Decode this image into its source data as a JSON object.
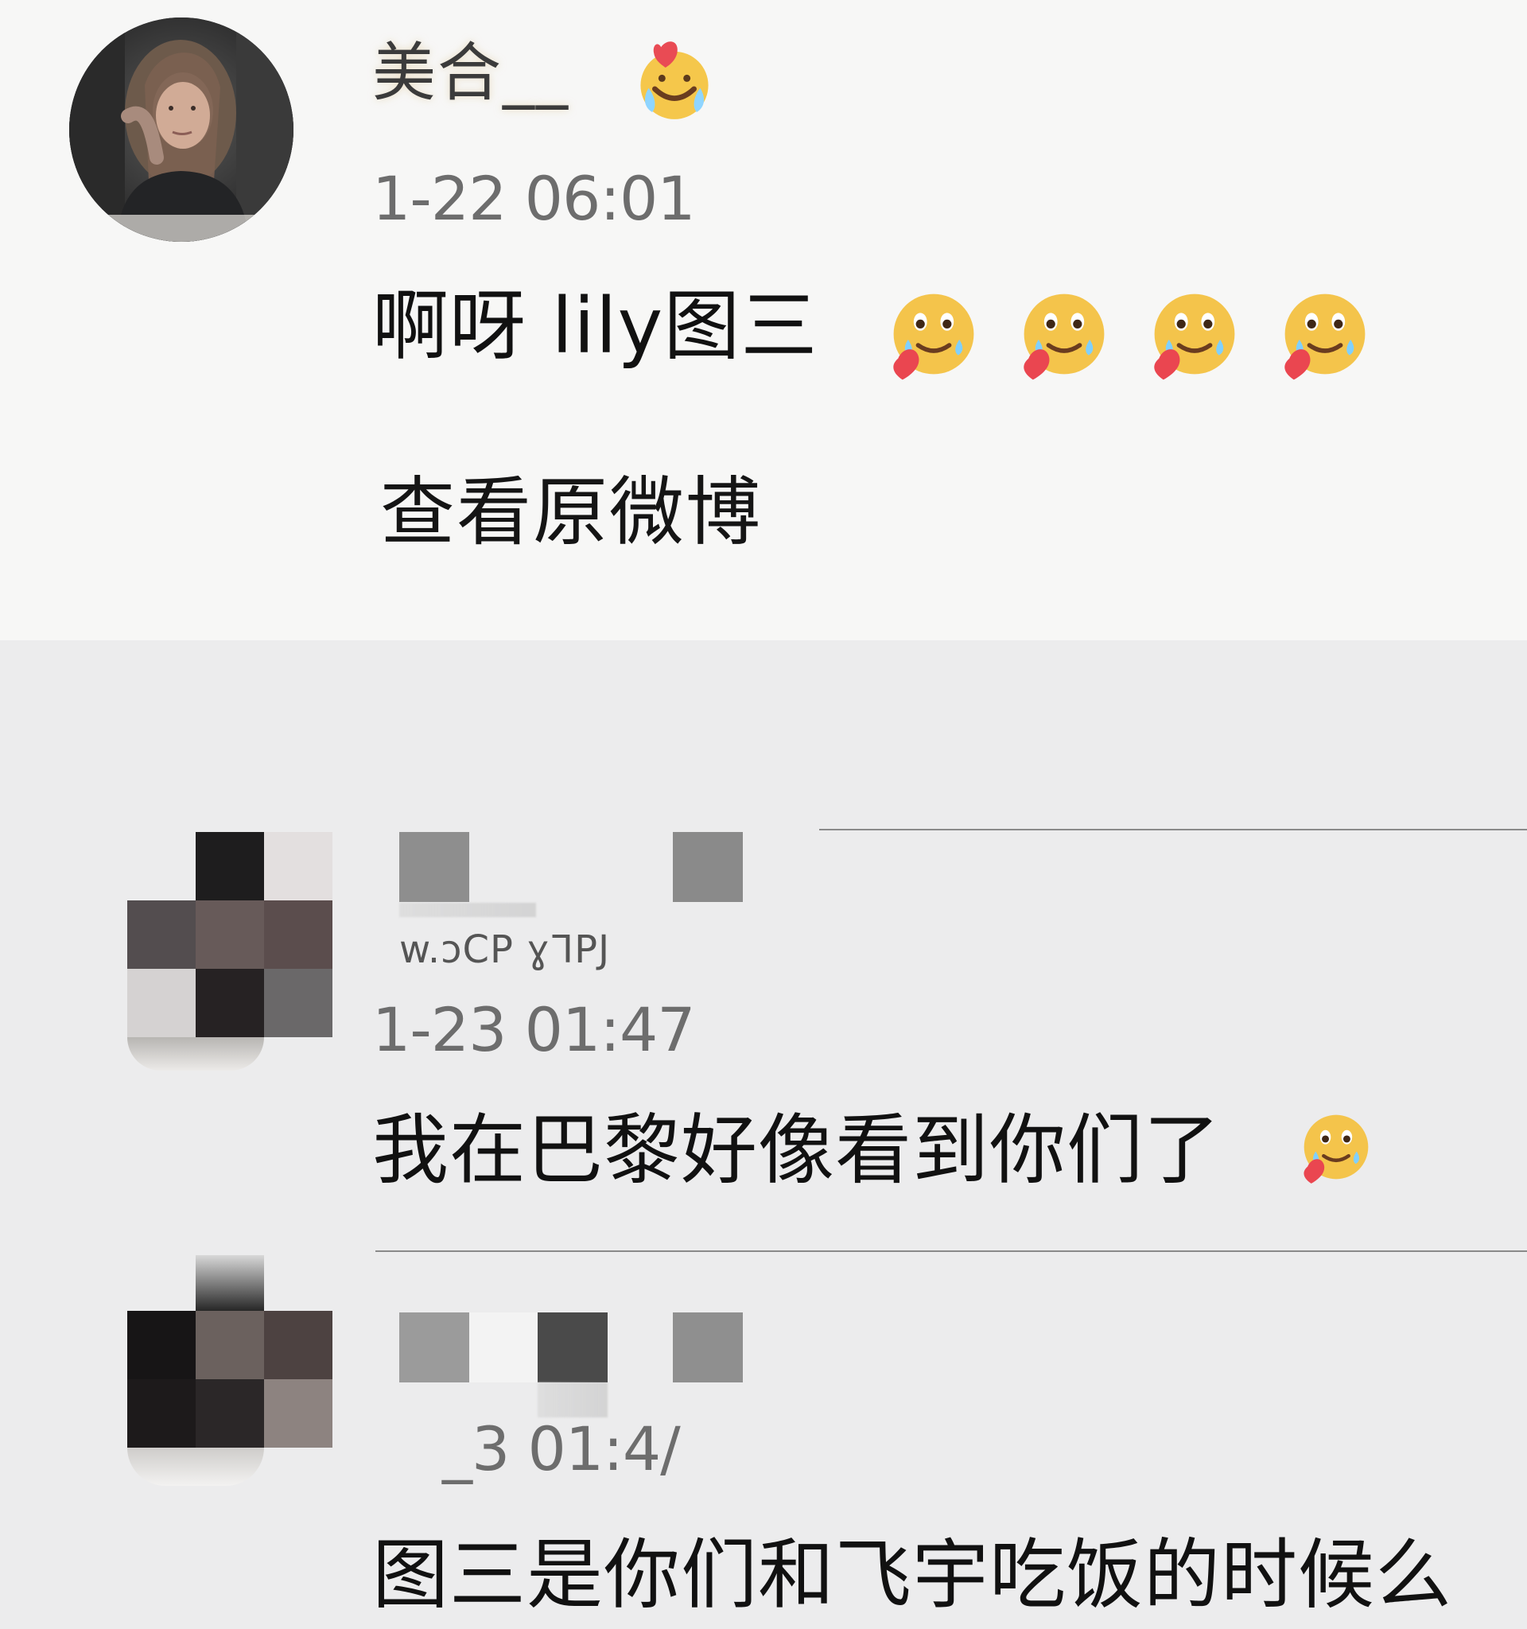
{
  "comments": [
    {
      "user": {
        "name": "美合__"
      },
      "timestamp": "1-22 06:01",
      "text": "啊呀 lily图三",
      "action_label": "查看原微博",
      "reaction_emoji_count": 4,
      "emoji_names": [
        "face-with-heart-icon",
        "smiling-with-tears-icon"
      ]
    },
    {
      "user": {
        "name_obscured_text": "w.ɔCP ɣᒣPJ"
      },
      "timestamp": "1-23 01:47",
      "text": "我在巴黎好像看到你们了",
      "reaction_emoji_count": 1,
      "emoji_names": [
        "smiling-with-tears-icon"
      ]
    },
    {
      "timestamp": "_3 01:4/",
      "text": "图三是你们和飞宇吃饭的时候么"
    }
  ],
  "colors": {
    "top_card_background": "#f7f7f6",
    "lower_background": "#ececed",
    "text_primary": "#111111",
    "text_secondary": "#6d6d6d",
    "divider": "#8a8a8a"
  }
}
